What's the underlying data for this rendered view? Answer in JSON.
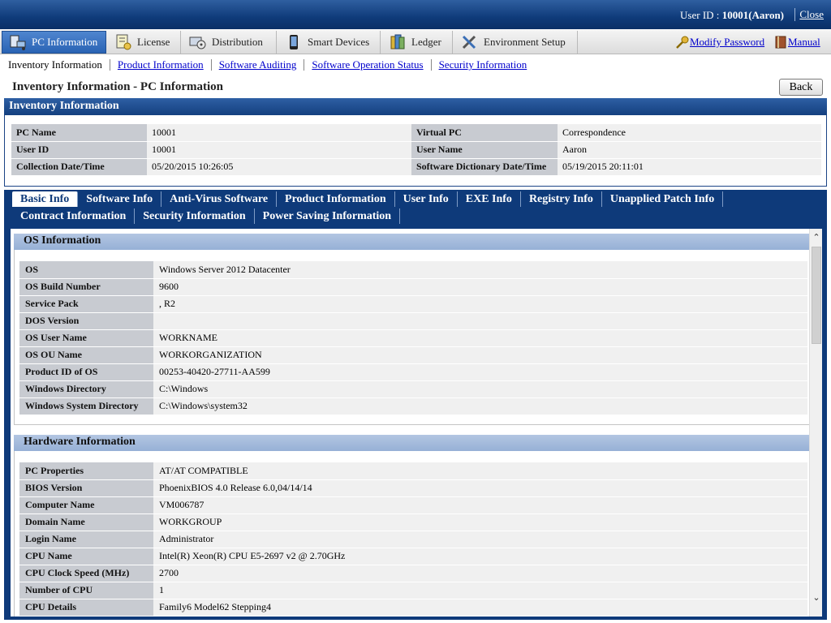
{
  "header": {
    "user_label": "User ID : ",
    "user_value": "10001(Aaron)",
    "close": "Close"
  },
  "main_menu": [
    {
      "label": "PC Information",
      "icon": "pc-icon",
      "active": true
    },
    {
      "label": "License",
      "icon": "license-icon"
    },
    {
      "label": "Distribution",
      "icon": "distribution-icon"
    },
    {
      "label": "Smart Devices",
      "icon": "smartphone-icon"
    },
    {
      "label": "Ledger",
      "icon": "ledger-icon"
    },
    {
      "label": "Environment Setup",
      "icon": "tools-icon"
    }
  ],
  "menu_right": {
    "modify_password": "Modify Password",
    "manual": "Manual"
  },
  "sub_nav": {
    "current": "Inventory Information",
    "links": [
      "Product Information",
      "Software Auditing",
      "Software Operation Status",
      "Security Information"
    ]
  },
  "page": {
    "title": "Inventory Information - PC Information",
    "back": "Back"
  },
  "inventory": {
    "heading": "Inventory Information",
    "rows": [
      {
        "l1": "PC Name",
        "v1": "10001",
        "l2": "Virtual PC",
        "v2": "Correspondence"
      },
      {
        "l1": "User ID",
        "v1": "10001",
        "l2": "User Name",
        "v2": "Aaron"
      },
      {
        "l1": "Collection Date/Time",
        "v1": "05/20/2015 10:26:05",
        "l2": "Software Dictionary Date/Time",
        "v2": "05/19/2015 20:11:01"
      }
    ]
  },
  "tabs": {
    "row1": [
      "Basic Info",
      "Software Info",
      "Anti-Virus Software",
      "Product Information",
      "User Info",
      "EXE Info",
      "Registry Info",
      "Unapplied Patch Info"
    ],
    "row2": [
      "Contract Information",
      "Security Information",
      "Power Saving Information"
    ],
    "active": "Basic Info"
  },
  "os_info": {
    "heading": "OS Information",
    "rows": [
      {
        "label": "OS",
        "value": "Windows Server 2012 Datacenter"
      },
      {
        "label": "OS Build Number",
        "value": "9600"
      },
      {
        "label": "Service Pack",
        "value": ", R2"
      },
      {
        "label": "DOS Version",
        "value": ""
      },
      {
        "label": "OS User Name",
        "value": "WORKNAME"
      },
      {
        "label": "OS OU Name",
        "value": "WORKORGANIZATION"
      },
      {
        "label": "Product ID of OS",
        "value": "00253-40420-27711-AA599"
      },
      {
        "label": "Windows Directory",
        "value": "C:\\Windows"
      },
      {
        "label": "Windows System Directory",
        "value": "C:\\Windows\\system32"
      }
    ]
  },
  "hw_info": {
    "heading": "Hardware Information",
    "rows": [
      {
        "label": "PC Properties",
        "value": "AT/AT COMPATIBLE"
      },
      {
        "label": "BIOS Version",
        "value": "PhoenixBIOS 4.0 Release 6.0,04/14/14"
      },
      {
        "label": "Computer Name",
        "value": "VM006787"
      },
      {
        "label": "Domain Name",
        "value": "WORKGROUP"
      },
      {
        "label": "Login Name",
        "value": "Administrator"
      },
      {
        "label": "CPU Name",
        "value": "Intel(R) Xeon(R) CPU E5-2697 v2 @ 2.70GHz"
      },
      {
        "label": "CPU Clock Speed (MHz)",
        "value": "2700"
      },
      {
        "label": "Number of CPU",
        "value": "1"
      },
      {
        "label": "CPU Details",
        "value": "Family6 Model62 Stepping4"
      }
    ]
  }
}
